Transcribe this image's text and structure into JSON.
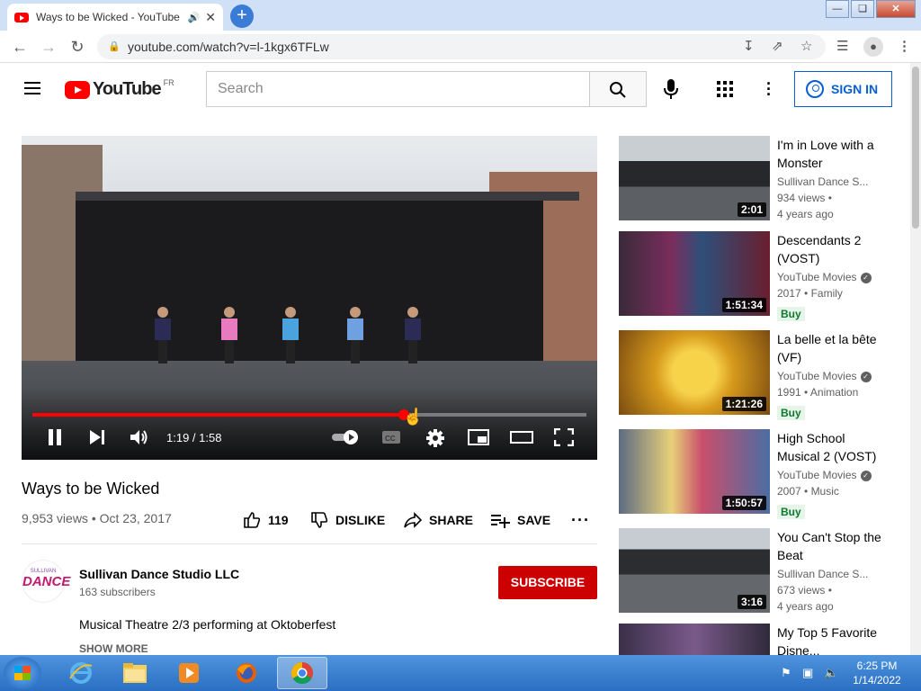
{
  "browser": {
    "tab_title": "Ways to be Wicked - YouTube",
    "url": "youtube.com/watch?v=l-1kgx6TFLw"
  },
  "header": {
    "logo_text": "YouTube",
    "country_code": "FR",
    "search_placeholder": "Search",
    "signin_label": "SIGN IN"
  },
  "player": {
    "time": "1:19 / 1:58",
    "progress": 0.67
  },
  "video": {
    "title": "Ways to be Wicked",
    "meta": "9,953 views • Oct 23, 2017",
    "likes": "119",
    "dislike_label": "DISLIKE",
    "share_label": "SHARE",
    "save_label": "SAVE"
  },
  "channel": {
    "avatar_top": "SULLIVAN",
    "avatar_main": "DANCE",
    "name": "Sullivan Dance Studio LLC",
    "subscribers": "163 subscribers",
    "subscribe_label": "SUBSCRIBE",
    "description": "Musical Theatre 2/3 performing at Oktoberfest",
    "show_more": "SHOW MORE"
  },
  "recommendations": [
    {
      "title": "I'm in Love with a Monster",
      "channel": "Sullivan Dance S...",
      "meta1": "934 views •",
      "meta2": "4 years ago",
      "duration": "2:01",
      "buy": "",
      "verified": false
    },
    {
      "title": "Descendants 2 (VOST)",
      "channel": "YouTube Movies",
      "meta1": "2017 • Family",
      "meta2": "",
      "duration": "1:51:34",
      "buy": "Buy",
      "verified": true
    },
    {
      "title": "La belle et la bête (VF)",
      "channel": "YouTube Movies",
      "meta1": "1991 • Animation",
      "meta2": "",
      "duration": "1:21:26",
      "buy": "Buy",
      "verified": true
    },
    {
      "title": "High School Musical 2 (VOST)",
      "channel": "YouTube Movies",
      "meta1": "2007 • Music",
      "meta2": "",
      "duration": "1:50:57",
      "buy": "Buy",
      "verified": true
    },
    {
      "title": "You Can't Stop the Beat",
      "channel": "Sullivan Dance S...",
      "meta1": "673 views •",
      "meta2": "4 years ago",
      "duration": "3:16",
      "buy": "",
      "verified": false
    },
    {
      "title": "My Top 5 Favorite Disne...",
      "channel": "",
      "meta1": "",
      "meta2": "",
      "duration": "",
      "buy": "",
      "verified": false
    }
  ],
  "taskbar": {
    "time": "6:25 PM",
    "date": "1/14/2022"
  },
  "colors": {
    "brand_red": "#ff0000",
    "subscribe_red": "#cc0000",
    "link_blue": "#065fd4"
  }
}
